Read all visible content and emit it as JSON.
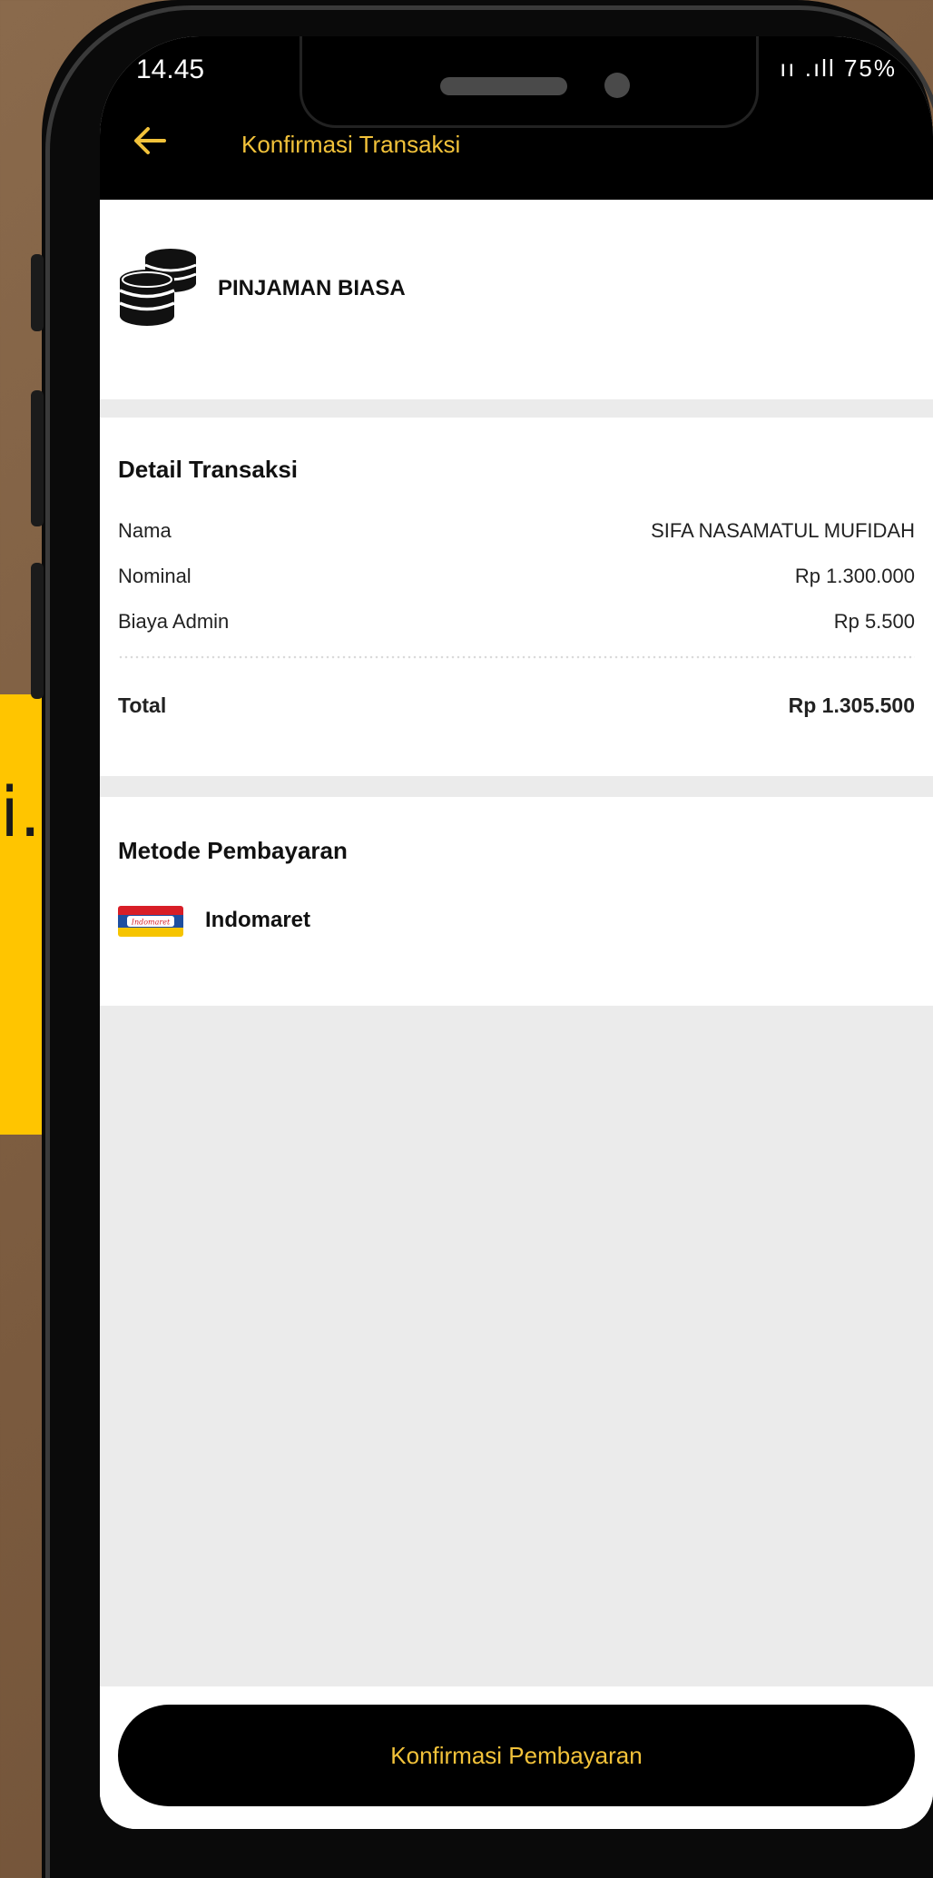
{
  "banner": {
    "text": "i."
  },
  "status_bar": {
    "time": "14.45",
    "indicators": "ıı .ıll 75%"
  },
  "header": {
    "title": "Konfirmasi Transaksi",
    "back_icon": "arrow-left-icon"
  },
  "product": {
    "icon": "coins-icon",
    "name": "PINJAMAN BIASA"
  },
  "detail": {
    "title": "Detail Transaksi",
    "rows": [
      {
        "label": "Nama",
        "value": "SIFA NASAMATUL MUFIDAH"
      },
      {
        "label": "Nominal",
        "value": "Rp 1.300.000"
      },
      {
        "label": "Biaya Admin",
        "value": "Rp 5.500"
      }
    ],
    "total": {
      "label": "Total",
      "value": "Rp 1.305.500"
    }
  },
  "payment": {
    "title": "Metode Pembayaran",
    "method": "Indomaret",
    "logo_text": "Indomaret"
  },
  "confirm_button": "Konfirmasi Pembayaran",
  "colors": {
    "accent": "#f2c23a",
    "header_bg": "#000000",
    "banner": "#ffc500",
    "screen_bg": "#ebebeb"
  }
}
